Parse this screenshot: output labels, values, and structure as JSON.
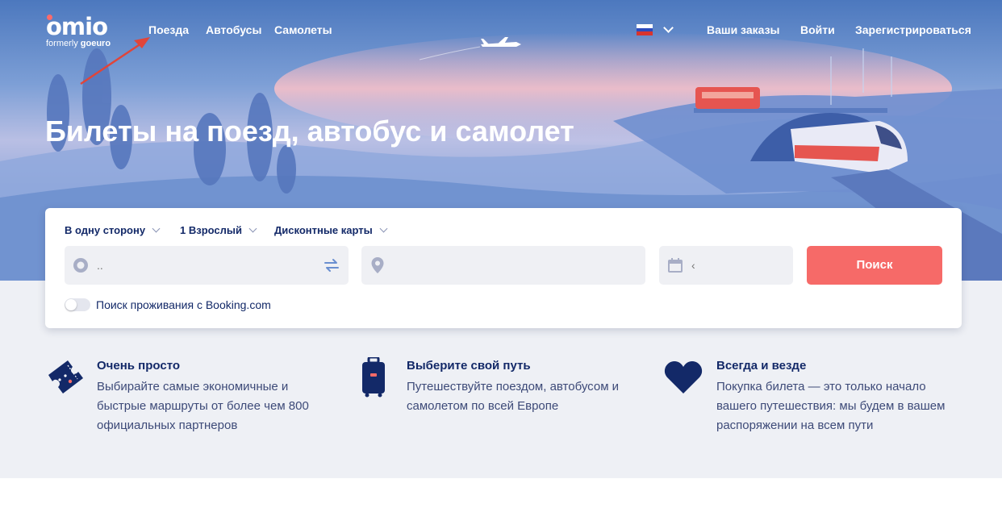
{
  "header": {
    "logo_text": "omio",
    "logo_sub_prefix": "formerly ",
    "logo_sub_brand": "goeuro",
    "nav": [
      "Поезда",
      "Автобусы",
      "Самолеты"
    ],
    "right_links": [
      "Ваши заказы",
      "Войти",
      "Зарегистрироваться"
    ],
    "language_flag": "russia-flag"
  },
  "hero": {
    "headline": "Билеты на поезд, автобус и самолет"
  },
  "search": {
    "trip_type": "В одну сторону",
    "passengers": "1 Взрослый",
    "discount_cards": "Дисконтные карты",
    "from_placeholder": "..",
    "to_placeholder": "",
    "date_placeholder": "‹",
    "button": "Поиск",
    "booking_toggle_label": "Поиск проживания с Booking.com",
    "booking_toggle_on": false
  },
  "features": [
    {
      "icon": "ticket-icon",
      "title": "Очень просто",
      "desc": [
        "Выбирайте самые экономичные и",
        "быстрые маршруты от более чем 800",
        "официальных партнеров"
      ]
    },
    {
      "icon": "suitcase-icon",
      "title": "Выберите свой путь",
      "desc": [
        "Путешествуйте поездом, автобусом и",
        "самолетом по всей Европе"
      ]
    },
    {
      "icon": "heart-icon",
      "title": "Всегда и везде",
      "desc": [
        "Покупка билета — это только начало",
        "вашего путешествия: мы будем в вашем",
        "распоряжении на всем пути"
      ]
    }
  ],
  "colors": {
    "accent": "#f66a68",
    "navy": "#132968",
    "hero_blue": "#6a8fd0",
    "annotation_arrow": "#e0453a"
  }
}
